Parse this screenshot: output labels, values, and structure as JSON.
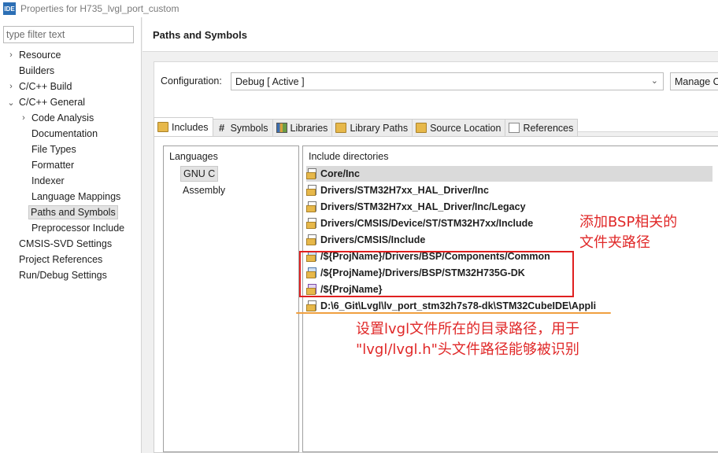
{
  "window": {
    "title": "Properties for H735_lvgl_port_custom",
    "app_icon_text": "IDE"
  },
  "sidebar": {
    "filter_placeholder": "type filter text",
    "items": [
      {
        "label": "Resource",
        "arrow": "›"
      },
      {
        "label": "Builders",
        "arrow": ""
      },
      {
        "label": "C/C++ Build",
        "arrow": "›"
      },
      {
        "label": "C/C++ General",
        "arrow": "⌄"
      },
      {
        "label": "Code Analysis",
        "arrow": "›"
      },
      {
        "label": "Documentation",
        "arrow": ""
      },
      {
        "label": "File Types",
        "arrow": ""
      },
      {
        "label": "Formatter",
        "arrow": ""
      },
      {
        "label": "Indexer",
        "arrow": ""
      },
      {
        "label": "Language Mappings",
        "arrow": ""
      },
      {
        "label": "Paths and Symbols",
        "arrow": ""
      },
      {
        "label": "Preprocessor Include",
        "arrow": ""
      },
      {
        "label": "CMSIS-SVD Settings",
        "arrow": ""
      },
      {
        "label": "Project References",
        "arrow": ""
      },
      {
        "label": "Run/Debug Settings",
        "arrow": ""
      }
    ]
  },
  "main": {
    "title": "Paths and Symbols",
    "configuration": {
      "label": "Configuration:",
      "value": "Debug  [ Active ]",
      "manage_label": "Manage C"
    },
    "tabs": [
      {
        "label": "Includes",
        "icon": "folder-icon"
      },
      {
        "label": "Symbols",
        "icon": "hash-icon"
      },
      {
        "label": "Libraries",
        "icon": "library-icon"
      },
      {
        "label": "Library Paths",
        "icon": "folder-icon"
      },
      {
        "label": "Source Location",
        "icon": "folder-icon"
      },
      {
        "label": "References",
        "icon": "file-icon"
      }
    ],
    "languages": {
      "header": "Languages",
      "items": [
        "GNU C",
        "Assembly"
      ]
    },
    "includes": {
      "header": "Include directories",
      "rows": [
        {
          "path": "Core/Inc",
          "icon": "folder-icon"
        },
        {
          "path": "Drivers/STM32H7xx_HAL_Driver/Inc",
          "icon": "folder-icon"
        },
        {
          "path": "Drivers/STM32H7xx_HAL_Driver/Inc/Legacy",
          "icon": "folder-icon"
        },
        {
          "path": "Drivers/CMSIS/Device/ST/STM32H7xx/Include",
          "icon": "folder-icon"
        },
        {
          "path": "Drivers/CMSIS/Include",
          "icon": "folder-icon"
        },
        {
          "path": "/${ProjName}/Drivers/BSP/Components/Common",
          "icon": "workspace-folder-icon"
        },
        {
          "path": "/${ProjName}/Drivers/BSP/STM32H735G-DK",
          "icon": "workspace-folder-icon"
        },
        {
          "path": "/${ProjName}",
          "icon": "project-folder-icon"
        },
        {
          "path": "D:\\6_Git\\Lvgl\\lv_port_stm32h7s78-dk\\STM32CubeIDE\\Appli",
          "icon": "folder-icon"
        }
      ]
    }
  },
  "annotations": {
    "bsp_line1": "添加BSP相关的",
    "bsp_line2": "文件夹路径",
    "lvgl_line1": "设置lvgl文件所在的目录路径，用于",
    "lvgl_line2": "\"lvgl/lvgl.h\"头文件路径能够被识别"
  }
}
